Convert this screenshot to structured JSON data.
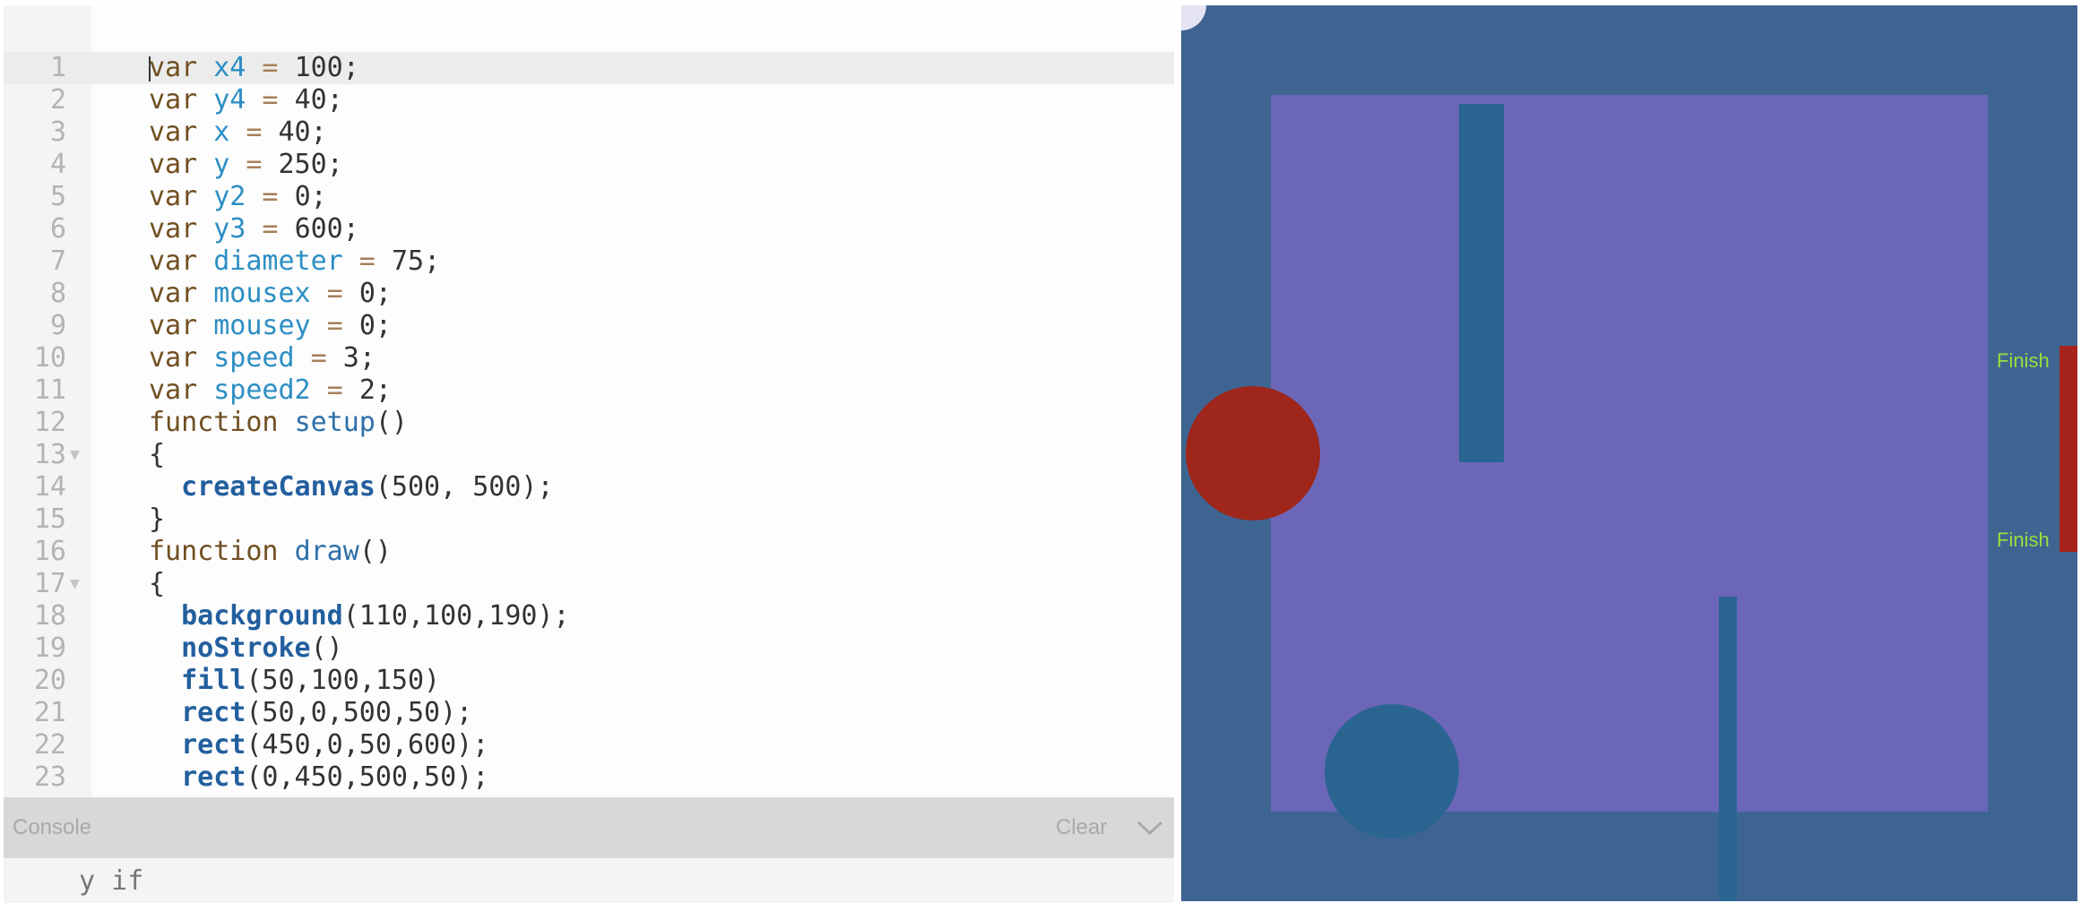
{
  "editor": {
    "lines": [
      {
        "n": "1",
        "fold": false,
        "tokens": [
          [
            "kw",
            "var"
          ],
          [
            "pl",
            " "
          ],
          [
            "vn",
            "x4"
          ],
          [
            "op",
            " = "
          ],
          [
            "nm",
            "100"
          ],
          [
            "pl",
            ";"
          ]
        ]
      },
      {
        "n": "2",
        "fold": false,
        "tokens": [
          [
            "kw",
            "var"
          ],
          [
            "pl",
            " "
          ],
          [
            "vn",
            "y4"
          ],
          [
            "op",
            " = "
          ],
          [
            "nm",
            "40"
          ],
          [
            "pl",
            ";"
          ]
        ]
      },
      {
        "n": "3",
        "fold": false,
        "tokens": [
          [
            "kw",
            "var"
          ],
          [
            "pl",
            " "
          ],
          [
            "vn",
            "x"
          ],
          [
            "op",
            " = "
          ],
          [
            "nm",
            "40"
          ],
          [
            "pl",
            ";"
          ]
        ]
      },
      {
        "n": "4",
        "fold": false,
        "tokens": [
          [
            "kw",
            "var"
          ],
          [
            "pl",
            " "
          ],
          [
            "vn",
            "y"
          ],
          [
            "op",
            " = "
          ],
          [
            "nm",
            "250"
          ],
          [
            "pl",
            ";"
          ]
        ]
      },
      {
        "n": "5",
        "fold": false,
        "tokens": [
          [
            "kw",
            "var"
          ],
          [
            "pl",
            " "
          ],
          [
            "vn",
            "y2"
          ],
          [
            "op",
            " = "
          ],
          [
            "nm",
            "0"
          ],
          [
            "pl",
            ";"
          ]
        ]
      },
      {
        "n": "6",
        "fold": false,
        "tokens": [
          [
            "kw",
            "var"
          ],
          [
            "pl",
            " "
          ],
          [
            "vn",
            "y3"
          ],
          [
            "op",
            " = "
          ],
          [
            "nm",
            "600"
          ],
          [
            "pl",
            ";"
          ]
        ]
      },
      {
        "n": "7",
        "fold": false,
        "tokens": [
          [
            "kw",
            "var"
          ],
          [
            "pl",
            " "
          ],
          [
            "vn",
            "diameter"
          ],
          [
            "op",
            " = "
          ],
          [
            "nm",
            "75"
          ],
          [
            "pl",
            ";"
          ]
        ]
      },
      {
        "n": "8",
        "fold": false,
        "tokens": [
          [
            "kw",
            "var"
          ],
          [
            "pl",
            " "
          ],
          [
            "vn",
            "mousex"
          ],
          [
            "op",
            " = "
          ],
          [
            "nm",
            "0"
          ],
          [
            "pl",
            ";"
          ]
        ]
      },
      {
        "n": "9",
        "fold": false,
        "tokens": [
          [
            "kw",
            "var"
          ],
          [
            "pl",
            " "
          ],
          [
            "vn",
            "mousey"
          ],
          [
            "op",
            " = "
          ],
          [
            "nm",
            "0"
          ],
          [
            "pl",
            ";"
          ]
        ]
      },
      {
        "n": "10",
        "fold": false,
        "tokens": [
          [
            "kw",
            "var"
          ],
          [
            "pl",
            " "
          ],
          [
            "vn",
            "speed"
          ],
          [
            "op",
            " = "
          ],
          [
            "nm",
            "3"
          ],
          [
            "pl",
            ";"
          ]
        ]
      },
      {
        "n": "11",
        "fold": false,
        "tokens": [
          [
            "kw",
            "var"
          ],
          [
            "pl",
            " "
          ],
          [
            "vn",
            "speed2"
          ],
          [
            "op",
            " = "
          ],
          [
            "nm",
            "2"
          ],
          [
            "pl",
            ";"
          ]
        ]
      },
      {
        "n": "12",
        "fold": false,
        "tokens": [
          [
            "kw",
            "function"
          ],
          [
            "pl",
            " "
          ],
          [
            "fn",
            "setup"
          ],
          [
            "pl",
            "()"
          ]
        ]
      },
      {
        "n": "13",
        "fold": true,
        "tokens": [
          [
            "pl",
            "{"
          ]
        ]
      },
      {
        "n": "14",
        "fold": false,
        "tokens": [
          [
            "pl",
            "  "
          ],
          [
            "bf",
            "createCanvas"
          ],
          [
            "pl",
            "(500, 500);"
          ]
        ]
      },
      {
        "n": "15",
        "fold": false,
        "tokens": [
          [
            "pl",
            "}"
          ]
        ]
      },
      {
        "n": "16",
        "fold": false,
        "tokens": [
          [
            "kw",
            "function"
          ],
          [
            "pl",
            " "
          ],
          [
            "fn",
            "draw"
          ],
          [
            "pl",
            "()"
          ]
        ]
      },
      {
        "n": "17",
        "fold": true,
        "tokens": [
          [
            "pl",
            "{"
          ]
        ]
      },
      {
        "n": "18",
        "fold": false,
        "tokens": [
          [
            "pl",
            "  "
          ],
          [
            "bf",
            "background"
          ],
          [
            "pl",
            "(110,100,190);"
          ]
        ]
      },
      {
        "n": "19",
        "fold": false,
        "tokens": [
          [
            "pl",
            "  "
          ],
          [
            "bf",
            "noStroke"
          ],
          [
            "pl",
            "()"
          ]
        ]
      },
      {
        "n": "20",
        "fold": false,
        "tokens": [
          [
            "pl",
            "  "
          ],
          [
            "bf",
            "fill"
          ],
          [
            "pl",
            "(50,100,150)"
          ]
        ]
      },
      {
        "n": "21",
        "fold": false,
        "tokens": [
          [
            "pl",
            "  "
          ],
          [
            "bf",
            "rect"
          ],
          [
            "pl",
            "(50,0,500,50);"
          ]
        ]
      },
      {
        "n": "22",
        "fold": false,
        "tokens": [
          [
            "pl",
            "  "
          ],
          [
            "bf",
            "rect"
          ],
          [
            "pl",
            "(450,0,50,600);"
          ]
        ]
      },
      {
        "n": "23",
        "fold": false,
        "tokens": [
          [
            "pl",
            "  "
          ],
          [
            "bf",
            "rect"
          ],
          [
            "pl",
            "(0,450,500,50);"
          ]
        ]
      }
    ]
  },
  "console": {
    "title": "Console",
    "clear_label": "Clear",
    "output": "y if"
  },
  "canvas": {
    "finish_top": "Finish",
    "finish_bottom": "Finish",
    "colors": {
      "background": "#3e6592",
      "field": "#6c66b8",
      "obstacle": "#2a6591",
      "player": "#9e261a",
      "finish_bar": "#a6231b",
      "finish_text": "#9ddc3d"
    }
  }
}
